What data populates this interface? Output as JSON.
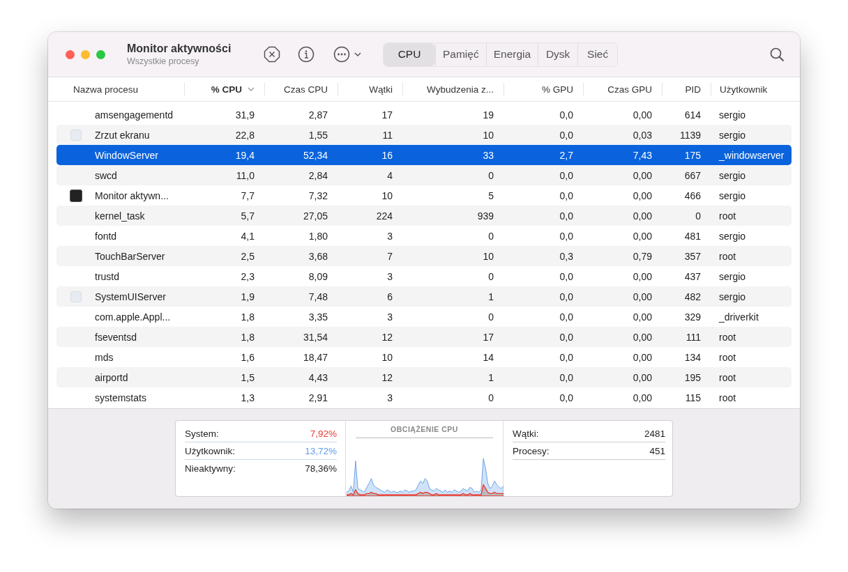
{
  "window": {
    "title": "Monitor aktywności",
    "subtitle": "Wszystkie procesy"
  },
  "tabs": [
    {
      "label": "CPU",
      "selected": true
    },
    {
      "label": "Pamięć",
      "selected": false
    },
    {
      "label": "Energia",
      "selected": false
    },
    {
      "label": "Dysk",
      "selected": false
    },
    {
      "label": "Sieć",
      "selected": false
    }
  ],
  "table": {
    "columns": [
      {
        "label": "Nazwa procesu",
        "sorted": false
      },
      {
        "label": "% CPU",
        "sorted": true
      },
      {
        "label": "Czas CPU",
        "sorted": false
      },
      {
        "label": "Wątki",
        "sorted": false
      },
      {
        "label": "Wybudzenia z...",
        "sorted": false
      },
      {
        "label": "% GPU",
        "sorted": false
      },
      {
        "label": "Czas GPU",
        "sorted": false
      },
      {
        "label": "PID",
        "sorted": false
      },
      {
        "label": "Użytkownik",
        "sorted": false
      }
    ],
    "rows": [
      {
        "kind": "plain",
        "selected": false,
        "cells": [
          "amsengagementd",
          "31,9",
          "2,87",
          "17",
          "19",
          "0,0",
          "0,00",
          "614",
          "sergio"
        ]
      },
      {
        "kind": "light-icon",
        "selected": false,
        "cells": [
          "Zrzut ekranu",
          "22,8",
          "1,55",
          "11",
          "10",
          "0,0",
          "0,03",
          "1139",
          "sergio"
        ]
      },
      {
        "kind": "plain",
        "selected": true,
        "cells": [
          "WindowServer",
          "19,4",
          "52,34",
          "16",
          "33",
          "2,7",
          "7,43",
          "175",
          "_windowserver"
        ]
      },
      {
        "kind": "plain",
        "selected": false,
        "cells": [
          "swcd",
          "11,0",
          "2,84",
          "4",
          "0",
          "0,0",
          "0,00",
          "667",
          "sergio"
        ]
      },
      {
        "kind": "dark-icon",
        "selected": false,
        "cells": [
          "Monitor aktywn...",
          "7,7",
          "7,32",
          "10",
          "5",
          "0,0",
          "0,00",
          "466",
          "sergio"
        ]
      },
      {
        "kind": "plain",
        "selected": false,
        "cells": [
          "kernel_task",
          "5,7",
          "27,05",
          "224",
          "939",
          "0,0",
          "0,00",
          "0",
          "root"
        ]
      },
      {
        "kind": "plain",
        "selected": false,
        "cells": [
          "fontd",
          "4,1",
          "1,80",
          "3",
          "0",
          "0,0",
          "0,00",
          "481",
          "sergio"
        ]
      },
      {
        "kind": "plain",
        "selected": false,
        "cells": [
          "TouchBarServer",
          "2,5",
          "3,68",
          "7",
          "10",
          "0,3",
          "0,79",
          "357",
          "root"
        ]
      },
      {
        "kind": "plain",
        "selected": false,
        "cells": [
          "trustd",
          "2,3",
          "8,09",
          "3",
          "0",
          "0,0",
          "0,00",
          "437",
          "sergio"
        ]
      },
      {
        "kind": "light-icon",
        "selected": false,
        "cells": [
          "SystemUIServer",
          "1,9",
          "7,48",
          "6",
          "1",
          "0,0",
          "0,00",
          "482",
          "sergio"
        ]
      },
      {
        "kind": "plain",
        "selected": false,
        "cells": [
          "com.apple.Appl...",
          "1,8",
          "3,35",
          "3",
          "0",
          "0,0",
          "0,00",
          "329",
          "_driverkit"
        ]
      },
      {
        "kind": "plain",
        "selected": false,
        "cells": [
          "fseventsd",
          "1,8",
          "31,54",
          "12",
          "17",
          "0,0",
          "0,00",
          "111",
          "root"
        ]
      },
      {
        "kind": "plain",
        "selected": false,
        "cells": [
          "mds",
          "1,6",
          "18,47",
          "10",
          "14",
          "0,0",
          "0,00",
          "134",
          "root"
        ]
      },
      {
        "kind": "plain",
        "selected": false,
        "cells": [
          "airportd",
          "1,5",
          "4,43",
          "12",
          "1",
          "0,0",
          "0,00",
          "195",
          "root"
        ]
      },
      {
        "kind": "plain",
        "selected": false,
        "cells": [
          "systemstats",
          "1,3",
          "2,91",
          "3",
          "0",
          "0,0",
          "0,00",
          "115",
          "root"
        ]
      }
    ]
  },
  "summary": {
    "load": [
      {
        "label": "System:",
        "value": "7,92%",
        "color": "#e8382f"
      },
      {
        "label": "Użytkownik:",
        "value": "13,72%",
        "color": "#5d9cec"
      },
      {
        "label": "Nieaktywny:",
        "value": "78,36%",
        "color": "#1d1d1f"
      }
    ],
    "chart_title": "OBCIĄŻENIE CPU",
    "counts": [
      {
        "label": "Wątki:",
        "value": "2481"
      },
      {
        "label": "Procesy:",
        "value": "451"
      }
    ]
  }
}
